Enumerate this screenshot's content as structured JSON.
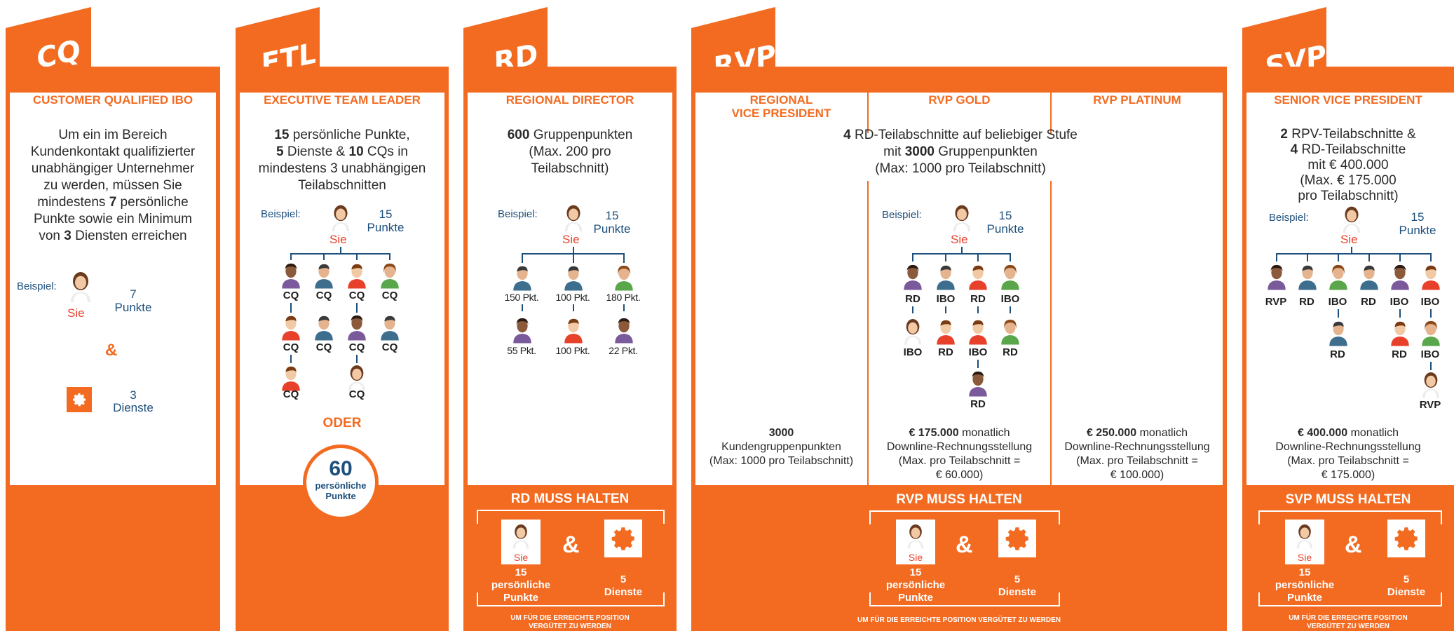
{
  "panels": {
    "cq": {
      "tab": "CQ",
      "title": "CUSTOMER QUALIFIED IBO",
      "desc_1": "Um ein im Bereich",
      "desc_2": "Kundenkontakt qualifizierter",
      "desc_3": "unabhängiger Unternehmer",
      "desc_4": "zu werden, müssen Sie",
      "desc_5a": "mindestens ",
      "desc_5b": "7",
      "desc_5c": " persönliche",
      "desc_6": "Punkte sowie ein Minimum",
      "desc_7a": "von ",
      "desc_7b": "3",
      "desc_7c": " Diensten erreichen",
      "example": "Beispiel:",
      "you": "Sie",
      "points_num": "7",
      "points_word": "Punkte",
      "amp": "&",
      "services_num": "3",
      "services_word": "Dienste"
    },
    "etl": {
      "tab": "ETL",
      "title": "EXECUTIVE TEAM LEADER",
      "desc_1a": "15",
      "desc_1b": " persönliche Punkte,",
      "desc_2a": "5",
      "desc_2b": " Dienste & ",
      "desc_2c": "10",
      "desc_2d": " CQs in",
      "desc_3": "mindestens 3 unabhängigen",
      "desc_4": "Teilabschnitten",
      "example": "Beispiel:",
      "you": "Sie",
      "points_num": "15",
      "points_word": "Punkte",
      "row1": [
        "CQ",
        "CQ",
        "CQ",
        "CQ"
      ],
      "row2": [
        "CQ",
        "CQ",
        "CQ",
        "CQ"
      ],
      "row3a": "CQ",
      "row3b": "CQ",
      "oder": "ODER",
      "circle_num": "60",
      "circle_l1": "persönliche",
      "circle_l2": "Punkte"
    },
    "rd": {
      "tab": "RD",
      "title": "REGIONAL DIRECTOR",
      "desc_1a": "600",
      "desc_1b": " Gruppenpunkten",
      "desc_2": "(Max. 200 pro",
      "desc_3": "Teilabschnitt)",
      "example": "Beispiel:",
      "you": "Sie",
      "points_num": "15",
      "points_word": "Punkte",
      "row1": [
        "150 Pkt.",
        "100 Pkt.",
        "180 Pkt."
      ],
      "row2": [
        "55 Pkt.",
        "100 Pkt.",
        "22 Pkt."
      ],
      "hold_title": "RD MUSS HALTEN",
      "hold_you": "Sie",
      "hold_points_num": "15",
      "hold_points_l1": "persönliche",
      "hold_points_l2": "Punkte",
      "hold_amp": "&",
      "hold_services_num": "5",
      "hold_services_word": "Dienste",
      "foot_1": "UM FÜR DIE ERREICHTE POSITION",
      "foot_2": "VERGÜTET ZU WERDEN"
    },
    "rvp": {
      "tab": "RVP",
      "col1_title_1": "REGIONAL",
      "col1_title_2": "VICE PRESIDENT",
      "col2_title": "RVP GOLD",
      "col3_title": "RVP PLATINUM",
      "desc_1a": "4",
      "desc_1b": " RD-Teilabschnitte auf beliebiger Stufe",
      "desc_2a": "mit ",
      "desc_2b": "3000",
      "desc_2c": " Gruppenpunkten",
      "desc_3": "(Max: 1000 pro Teilabschnitt)",
      "example": "Beispiel:",
      "you": "Sie",
      "points_num": "15",
      "points_word": "Punkte",
      "row1": [
        "RD",
        "IBO",
        "RD",
        "IBO"
      ],
      "row2": [
        "IBO",
        "RD",
        "IBO",
        "RD"
      ],
      "row3": "RD",
      "col1_req_1": "3000",
      "col1_req_2": "Kundengruppenpunkten",
      "col1_req_3": "(Max: 1000 pro Teilabschnitt)",
      "col2_req_1a": "€ 175.000",
      "col2_req_1b": " monatlich",
      "col2_req_2": "Downline-Rechnungsstellung",
      "col2_req_3": "(Max. pro Teilabschnitt =",
      "col2_req_4": "€ 60.000)",
      "col3_req_1a": "€ 250.000",
      "col3_req_1b": " monatlich",
      "col3_req_2": "Downline-Rechnungsstellung",
      "col3_req_3": "(Max. pro Teilabschnitt =",
      "col3_req_4": "€ 100.000)",
      "hold_title": "RVP MUSS HALTEN",
      "hold_you": "Sie",
      "hold_points_num": "15",
      "hold_points_l1": "persönliche",
      "hold_points_l2": "Punkte",
      "hold_amp": "&",
      "hold_services_num": "5",
      "hold_services_word": "Dienste",
      "foot": "UM FÜR DIE ERREICHTE POSITION  VERGÜTET ZU WERDEN"
    },
    "svp": {
      "tab": "SVP",
      "title": "SENIOR VICE PRESIDENT",
      "desc_1a": "2",
      "desc_1b": " RPV-Teilabschnitte &",
      "desc_2a": "4",
      "desc_2b": " RD-Teilabschnitte",
      "desc_3": "mit € 400.000",
      "desc_4": "(Max. € 175.000",
      "desc_5": "pro Teilabschnitt)",
      "example": "Beispiel:",
      "you": "Sie",
      "points_num": "15",
      "points_word": "Punkte",
      "row1": [
        "RVP",
        "RD",
        "IBO",
        "RD",
        "IBO",
        "IBO"
      ],
      "row2": [
        "RD",
        "RD",
        "IBO"
      ],
      "row3": "RVP",
      "req_1a": "€ 400.000",
      "req_1b": " monatlich",
      "req_2": "Downline-Rechnungsstellung",
      "req_3": "(Max. pro Teilabschnitt =",
      "req_4": "€ 175.000)",
      "hold_title": "SVP MUSS HALTEN",
      "hold_you": "Sie",
      "hold_points_num": "15",
      "hold_points_l1": "persönliche",
      "hold_points_l2": "Punkte",
      "hold_amp": "&",
      "hold_services_num": "5",
      "hold_services_word": "Dienste",
      "foot_1": "UM FÜR DIE ERREICHTE POSITION",
      "foot_2": "VERGÜTET ZU WERDEN"
    }
  },
  "colors": {
    "accent": "#f36b21",
    "navy": "#1d4f7c",
    "red": "#e8412b"
  }
}
